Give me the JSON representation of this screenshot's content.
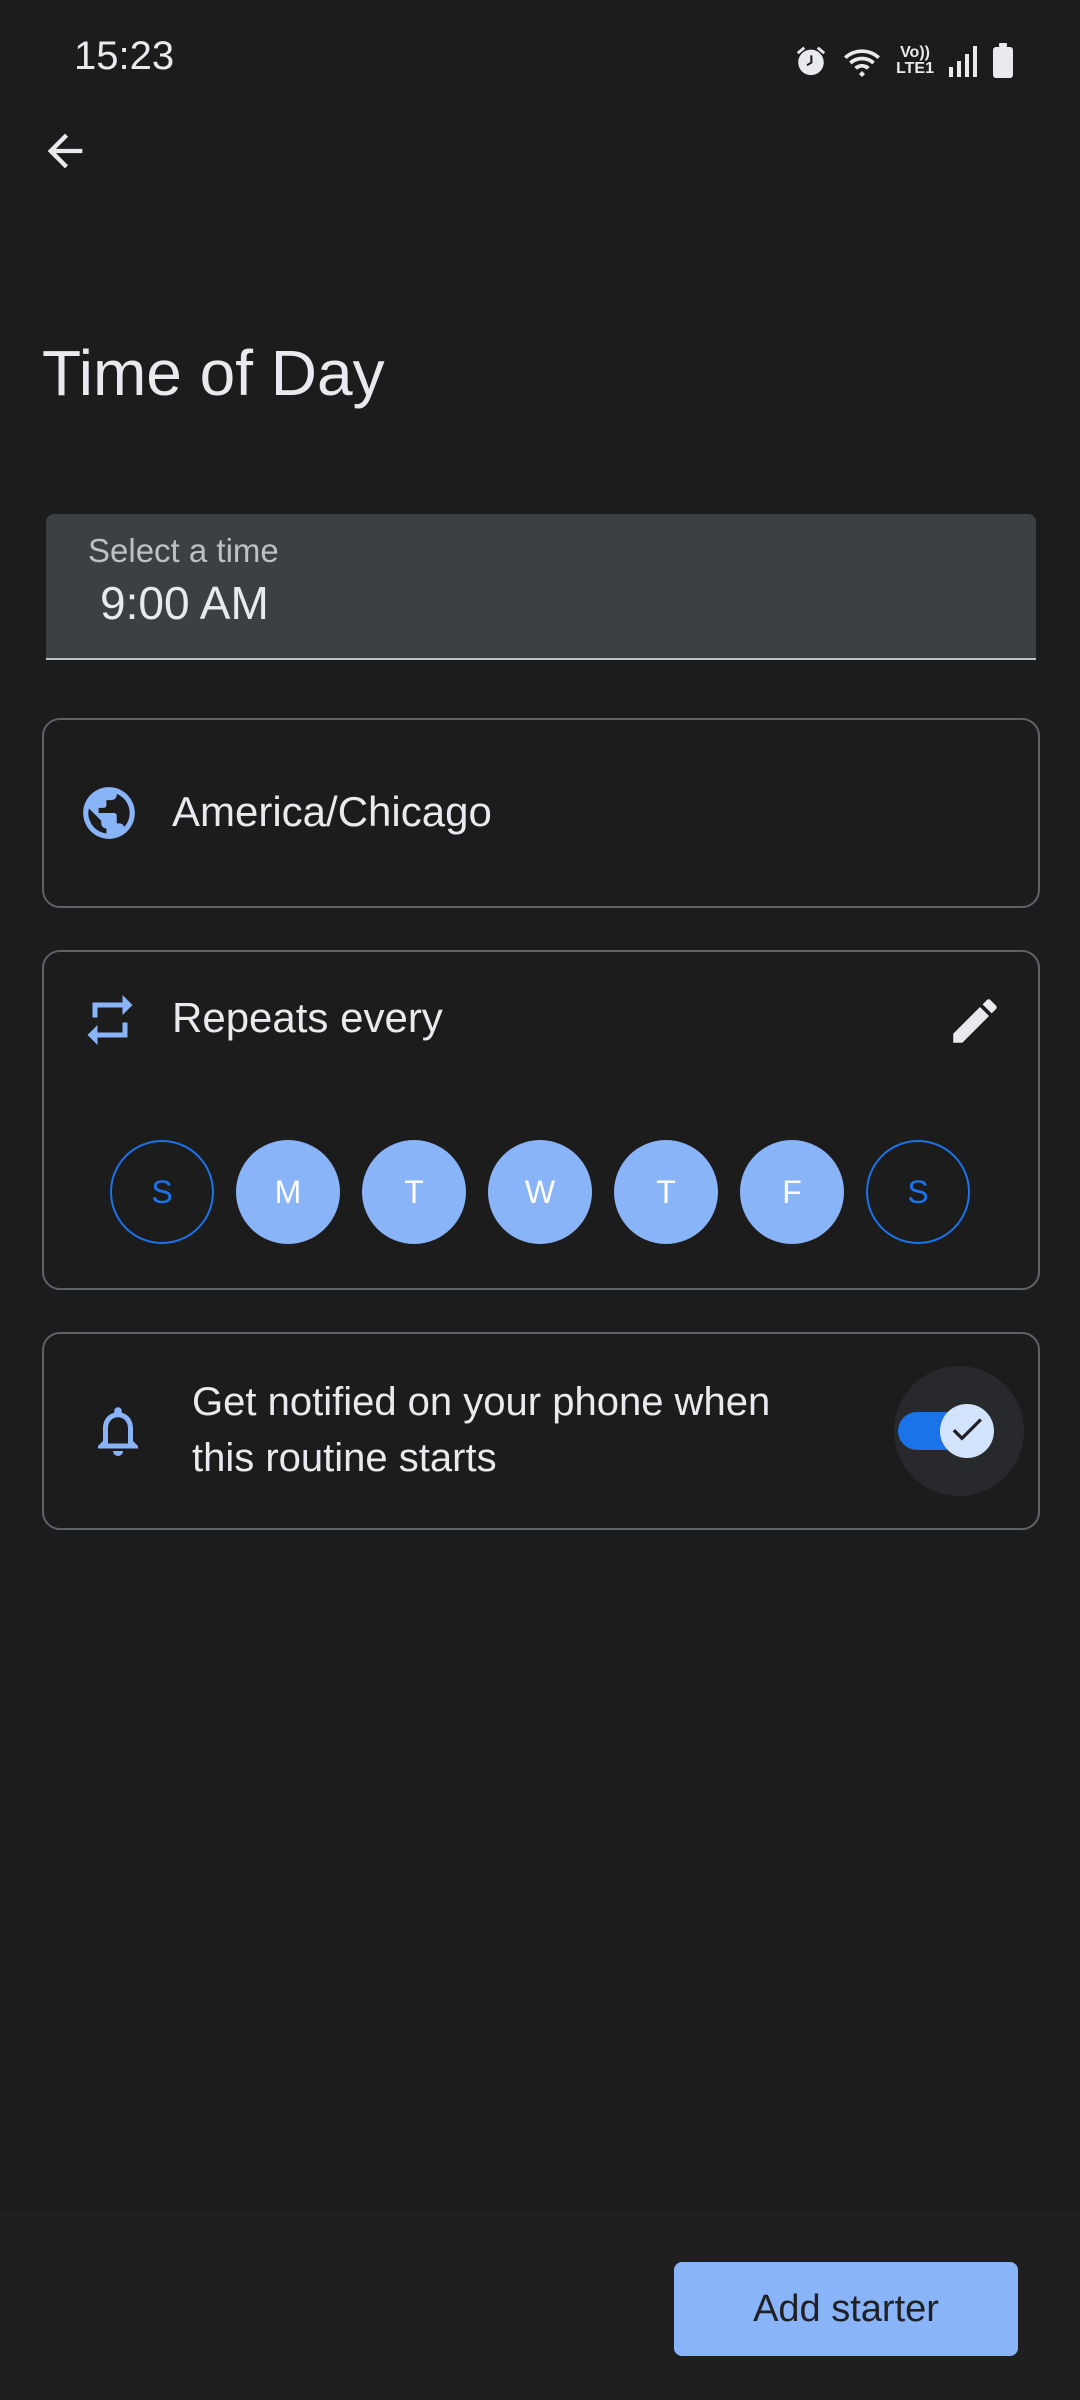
{
  "status_bar": {
    "time": "15:23",
    "volte_line1": "Vo))",
    "volte_line2": "LTE1",
    "icons": [
      "alarm-icon",
      "wifi-icon",
      "volte-indicator",
      "signal-icon",
      "battery-icon"
    ]
  },
  "header": {
    "back_icon": "arrow-back-icon",
    "title": "Time of Day"
  },
  "time_field": {
    "label": "Select a time",
    "value": "9:00 AM"
  },
  "timezone": {
    "icon": "globe-icon",
    "value": "America/Chicago"
  },
  "repeat": {
    "icon": "repeat-icon",
    "label": "Repeats every",
    "edit_icon": "pencil-icon",
    "days": [
      {
        "letter": "S",
        "selected": false
      },
      {
        "letter": "M",
        "selected": true
      },
      {
        "letter": "T",
        "selected": true
      },
      {
        "letter": "W",
        "selected": true
      },
      {
        "letter": "T",
        "selected": true
      },
      {
        "letter": "F",
        "selected": true
      },
      {
        "letter": "S",
        "selected": false
      }
    ]
  },
  "notify": {
    "icon": "bell-icon",
    "label": "Get notified on your phone when this routine starts",
    "enabled": true
  },
  "footer": {
    "add_starter_label": "Add starter"
  },
  "colors": {
    "background": "#1c1c1d",
    "accent": "#8ab4f8",
    "accent_strong": "#1a73e8",
    "card_border": "#5f6368",
    "field_bg": "#3c4043"
  }
}
